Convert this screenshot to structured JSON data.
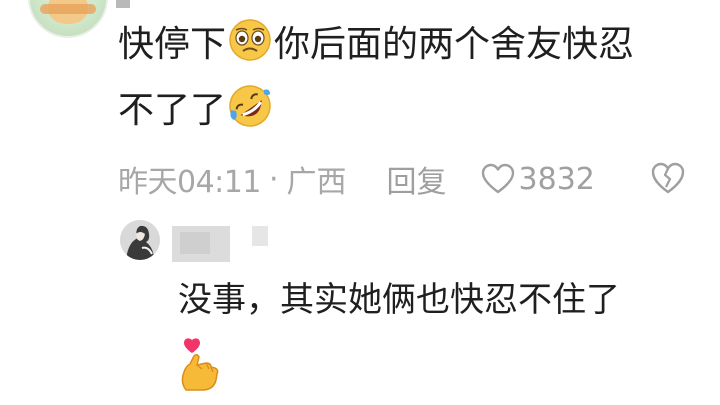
{
  "comment": {
    "line1_part1": "快停下",
    "line1_part2": "你后面的两个舍友快忍",
    "line2": "不了了",
    "emoji_1": "worried-face-emoji",
    "emoji_2": "rolling-on-floor-laughing-emoji",
    "time": "昨天04:11",
    "separator": "·",
    "location": "广西",
    "reply_label": "回复",
    "like_count": "3832",
    "icons": {
      "like": "heart-outline-icon",
      "dislike": "broken-heart-icon"
    }
  },
  "reply": {
    "text": "没事，其实她俩也快忍不住了",
    "emoji": "finger-heart-emoji"
  },
  "colors": {
    "text": "#1f1f1f",
    "meta": "#a7a7a7",
    "background": "#ffffff"
  }
}
